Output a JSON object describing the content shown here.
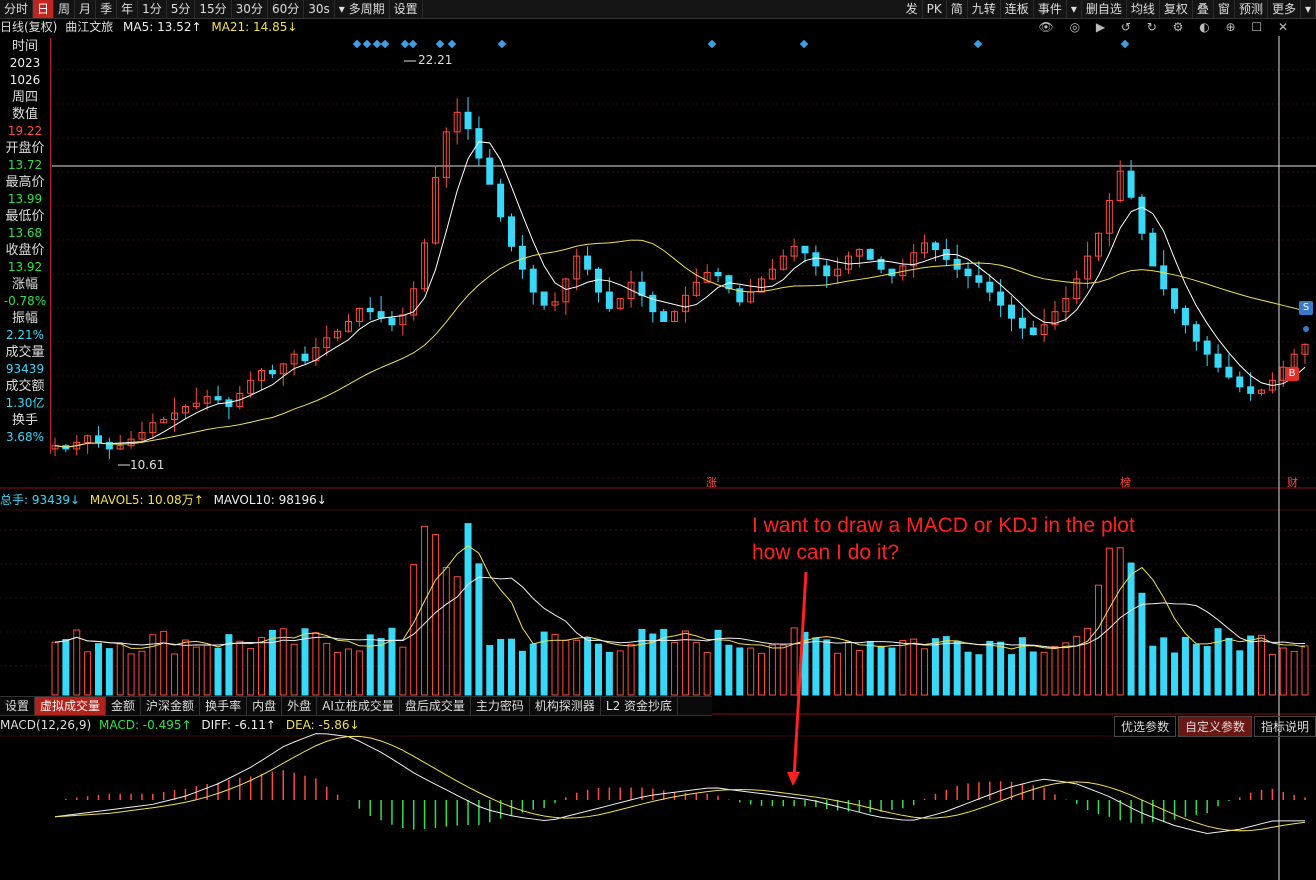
{
  "toolbar": {
    "left": [
      "分时",
      "日",
      "周",
      "月",
      "季",
      "年",
      "1分",
      "5分",
      "15分",
      "30分",
      "60分",
      "30s",
      "▾ 多周期",
      "设置"
    ],
    "active": "日",
    "right": [
      "发",
      "PK",
      "简",
      "九转",
      "连板",
      "事件",
      "▾",
      "删自选",
      "均线",
      "复权",
      "叠",
      "窗",
      "预测",
      "更多",
      "▾"
    ]
  },
  "info_line": {
    "period": "日线(复权)",
    "stock": "曲江文旅",
    "ma5": "MA5: 13.52↑",
    "ma21": "MA21: 14.85↓"
  },
  "sidebar": [
    {
      "label": "时间",
      "value": "2023",
      "color": "white"
    },
    {
      "label": "",
      "value": "1026",
      "color": "white"
    },
    {
      "label": "周四",
      "value": "",
      "color": "white"
    },
    {
      "label": "数值",
      "value": "19.22",
      "color": "red"
    },
    {
      "label": "开盘价",
      "value": "13.72",
      "color": "green"
    },
    {
      "label": "最高价",
      "value": "13.99",
      "color": "green"
    },
    {
      "label": "最低价",
      "value": "13.68",
      "color": "green"
    },
    {
      "label": "收盘价",
      "value": "13.92",
      "color": "green"
    },
    {
      "label": "涨幅",
      "value": "-0.78%",
      "color": "green"
    },
    {
      "label": "振幅",
      "value": "2.21%",
      "color": "cyan"
    },
    {
      "label": "成交量",
      "value": "93439",
      "color": "cyan"
    },
    {
      "label": "成交额",
      "value": "1.30亿",
      "color": "cyan"
    },
    {
      "label": "换手",
      "value": "3.68%",
      "color": "cyan"
    }
  ],
  "price_labels": {
    "high": "22.21",
    "low": "10.61"
  },
  "chart_markers": {
    "zhang": "涨",
    "bang": "榜",
    "cai": "财",
    "s": "S",
    "b": "B"
  },
  "volume_info": {
    "total": "总手: 93439↓",
    "mavol5": "MAVOL5: 10.08万↑",
    "mavol10": "MAVOL10: 98196↓"
  },
  "sub_tabs": [
    "设置",
    "虚拟成交量",
    "金额",
    "沪深金额",
    "换手率",
    "内盘",
    "外盘",
    "AI立桩成交量",
    "盘后成交量",
    "主力密码",
    "机构探测器",
    "L2 资金抄底"
  ],
  "sub_tab_active": "虚拟成交量",
  "macd_info": {
    "name": "MACD(12,26,9)",
    "macd": "MACD: -0.495↑",
    "diff": "DIFF: -6.11↑",
    "dea": "DEA: -5.86↓"
  },
  "macd_buttons": [
    "优选参数",
    "自定义参数",
    "指标说明"
  ],
  "macd_active": "自定义参数",
  "annotation": [
    "I want to draw a MACD or KDJ in the plot",
    "how can I do it?"
  ],
  "colors": {
    "up": "#ff4b3a",
    "down": "#38d8f8",
    "ma5": "#ffffff",
    "ma21": "#f0e050",
    "accent": "#c0261f"
  },
  "chart_data": {
    "type": "candlestick",
    "price_points": [
      10.8,
      10.7,
      10.9,
      11.1,
      10.9,
      10.7,
      10.8,
      11.0,
      11.2,
      11.5,
      11.6,
      11.8,
      12.0,
      12.1,
      12.3,
      12.2,
      12.0,
      12.4,
      12.8,
      13.1,
      13.0,
      13.3,
      13.6,
      13.4,
      13.8,
      14.1,
      14.3,
      14.6,
      15.0,
      14.9,
      14.7,
      14.5,
      14.8,
      15.6,
      17.0,
      19.0,
      20.4,
      21.0,
      20.5,
      19.6,
      18.8,
      17.8,
      16.9,
      16.2,
      15.5,
      15.1,
      15.2,
      15.9,
      16.6,
      16.2,
      15.5,
      15.0,
      15.3,
      15.8,
      15.4,
      14.9,
      14.6,
      14.9,
      15.4,
      15.8,
      16.1,
      16.0,
      15.6,
      15.2,
      15.5,
      15.9,
      16.2,
      16.6,
      16.9,
      16.7,
      16.3,
      16.0,
      16.2,
      16.6,
      16.8,
      16.5,
      16.2,
      16.0,
      16.3,
      16.7,
      17.0,
      16.8,
      16.5,
      16.2,
      16.0,
      15.8,
      15.5,
      15.1,
      14.7,
      14.4,
      14.2,
      14.5,
      14.9,
      15.3,
      15.9,
      16.6,
      17.3,
      18.3,
      19.2,
      18.4,
      17.3,
      16.3,
      15.6,
      15.0,
      14.5,
      14.0,
      13.6,
      13.2,
      12.9,
      12.6,
      12.4,
      12.5,
      12.8,
      13.2,
      13.6,
      13.9
    ],
    "macd_points": [
      -0.4,
      -0.3,
      -0.2,
      -0.1,
      0.1,
      0.4,
      0.8,
      1.3,
      1.6,
      1.5,
      1.1,
      0.6,
      0.2,
      -0.2,
      -0.4,
      -0.5,
      -0.3,
      -0.1,
      0.1,
      0.2,
      0.3,
      0.2,
      0.1,
      0.0,
      -0.2,
      -0.4,
      -0.5,
      -0.3,
      0.0,
      0.3,
      0.5,
      0.4,
      0.1,
      -0.3,
      -0.6,
      -0.8,
      -0.7,
      -0.5,
      -0.495
    ]
  }
}
